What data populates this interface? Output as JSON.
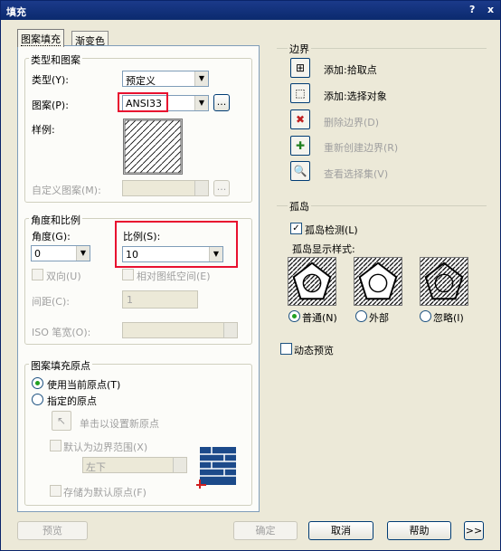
{
  "window": {
    "title": "填充",
    "help_btn": "?",
    "close_btn": "x"
  },
  "tabs": [
    "图案填充",
    "渐变色"
  ],
  "type_pattern": {
    "legend": "类型和图案",
    "type_label": "类型(Y):",
    "type_value": "预定义",
    "pattern_label": "图案(P):",
    "pattern_value": "ANSI33",
    "browse": "...",
    "sample_label": "样例:",
    "custom_label": "自定义图案(M):",
    "custom_value": ""
  },
  "angle_scale": {
    "legend": "角度和比例",
    "angle_label": "角度(G):",
    "angle_value": "0",
    "scale_label": "比例(S):",
    "scale_value": "10",
    "double_label": "双向(U)",
    "paper_label": "相对图纸空间(E)",
    "spacing_label": "间距(C):",
    "spacing_value": "1",
    "iso_label": "ISO 笔宽(O):"
  },
  "origin": {
    "legend": "图案填充原点",
    "use_current": "使用当前原点(T)",
    "specified": "指定的原点",
    "click_set": "单击以设置新原点",
    "default_extents": "默认为边界范围(X)",
    "position_value": "左下",
    "store_default": "存储为默认原点(F)"
  },
  "boundaries": {
    "legend": "边界",
    "items": [
      "添加:拾取点",
      "添加:选择对象",
      "删除边界(D)",
      "重新创建边界(R)",
      "查看选择集(V)"
    ]
  },
  "islands": {
    "legend": "孤岛",
    "detect": "孤岛检测(L)",
    "style_label": "孤岛显示样式:",
    "styles": [
      "普通(N)",
      "外部",
      "忽略(I)"
    ]
  },
  "dynamic_preview": "动态预览",
  "footer": {
    "preview": "预览",
    "ok": "确定",
    "cancel": "取消",
    "help": "帮助",
    "more": ">>"
  }
}
